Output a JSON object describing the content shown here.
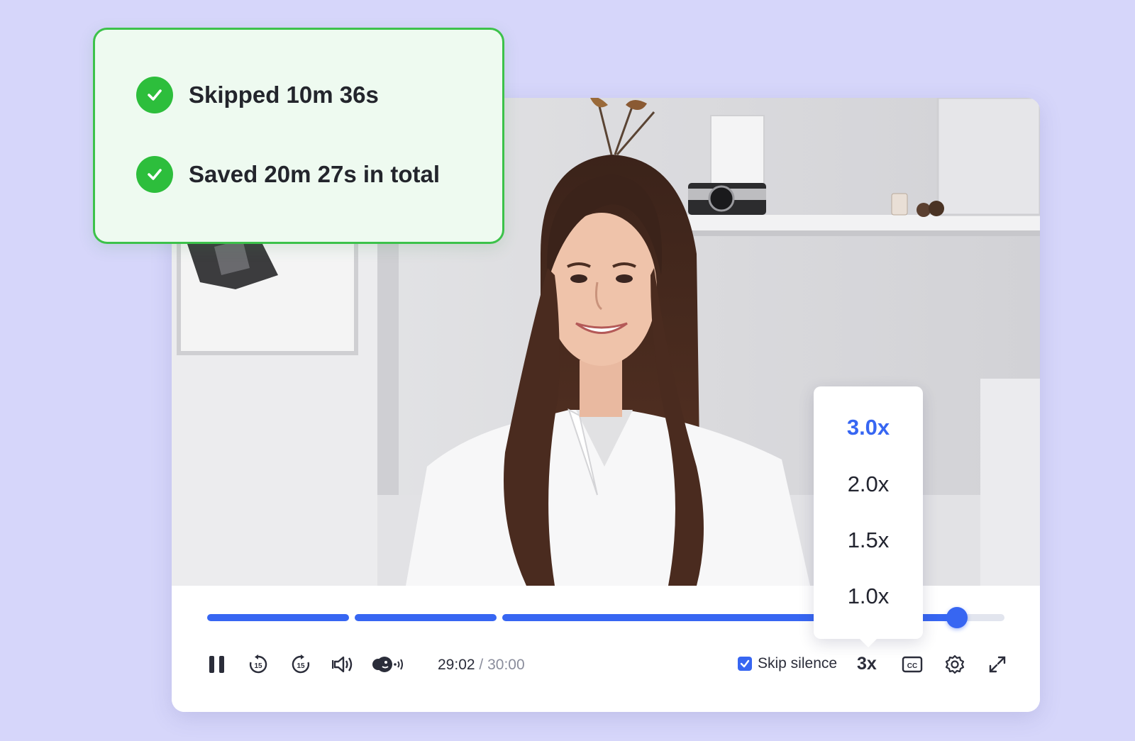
{
  "notification": {
    "items": [
      {
        "text": "Skipped 10m 36s",
        "icon": "check-circle-icon"
      },
      {
        "text": "Saved 20m 27s in total",
        "icon": "check-circle-icon"
      }
    ]
  },
  "player": {
    "progress_fraction": 0.94,
    "time": {
      "current": "29:02",
      "separator": "/",
      "duration": "30:00"
    },
    "skip_silence": {
      "label": "Skip silence",
      "checked": true
    },
    "speed_button_label": "3x",
    "speed_menu": {
      "options": [
        "3.0x",
        "2.0x",
        "1.5x",
        "1.0x"
      ],
      "selected": "3.0x"
    },
    "icons": {
      "pause": "pause-icon",
      "rewind": "rewind-15-icon",
      "forward": "forward-15-icon",
      "volume": "volume-icon",
      "voice": "voice-enhance-icon",
      "captions": "captions-icon",
      "settings": "gear-icon",
      "fullscreen": "fullscreen-icon"
    },
    "colors": {
      "accent": "#3766f2",
      "success": "#2dbe3c"
    }
  }
}
